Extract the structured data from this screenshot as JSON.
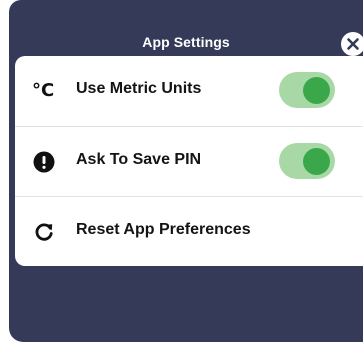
{
  "modal": {
    "title": "App Settings"
  },
  "settings": {
    "metric_units": {
      "icon": "celsius-icon",
      "icon_glyph": "°C",
      "label": "Use Metric Units",
      "enabled": true
    },
    "save_pin": {
      "icon": "exclamation-circle-icon",
      "label": "Ask To Save PIN",
      "enabled": true
    },
    "reset": {
      "icon": "refresh-icon",
      "label": "Reset App Preferences"
    }
  },
  "colors": {
    "modal_background": "#343a58",
    "card_background": "#ffffff",
    "toggle_track_on": "#a8d8a6",
    "toggle_knob_on": "#3aa84a"
  }
}
